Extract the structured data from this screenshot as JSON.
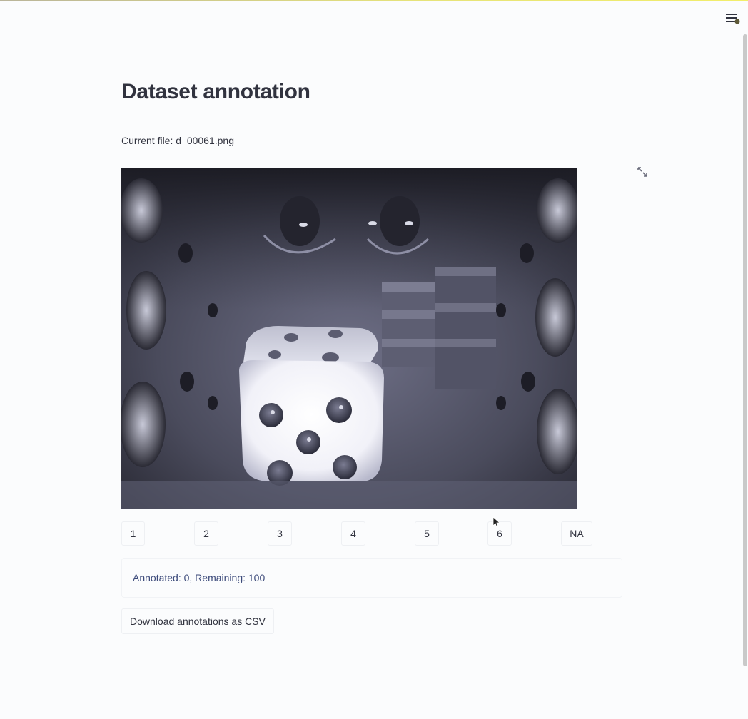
{
  "header": {
    "menu_icon": "hamburger-menu-icon"
  },
  "main": {
    "title": "Dataset annotation",
    "current_file_text": "Current file: d_00061.png",
    "image": {
      "description_icon": "die-photo",
      "fullscreen_icon": "expand-arrows-icon"
    },
    "label_buttons": [
      "1",
      "2",
      "3",
      "4",
      "5",
      "6",
      "NA"
    ],
    "status_text": "Annotated: 0, Remaining: 100",
    "download_label": "Download annotations as CSV"
  },
  "colors": {
    "background": "#fbfcfd",
    "text": "#31333f",
    "info_text": "#3c4a7a",
    "top_accent": "#e6e37a"
  }
}
